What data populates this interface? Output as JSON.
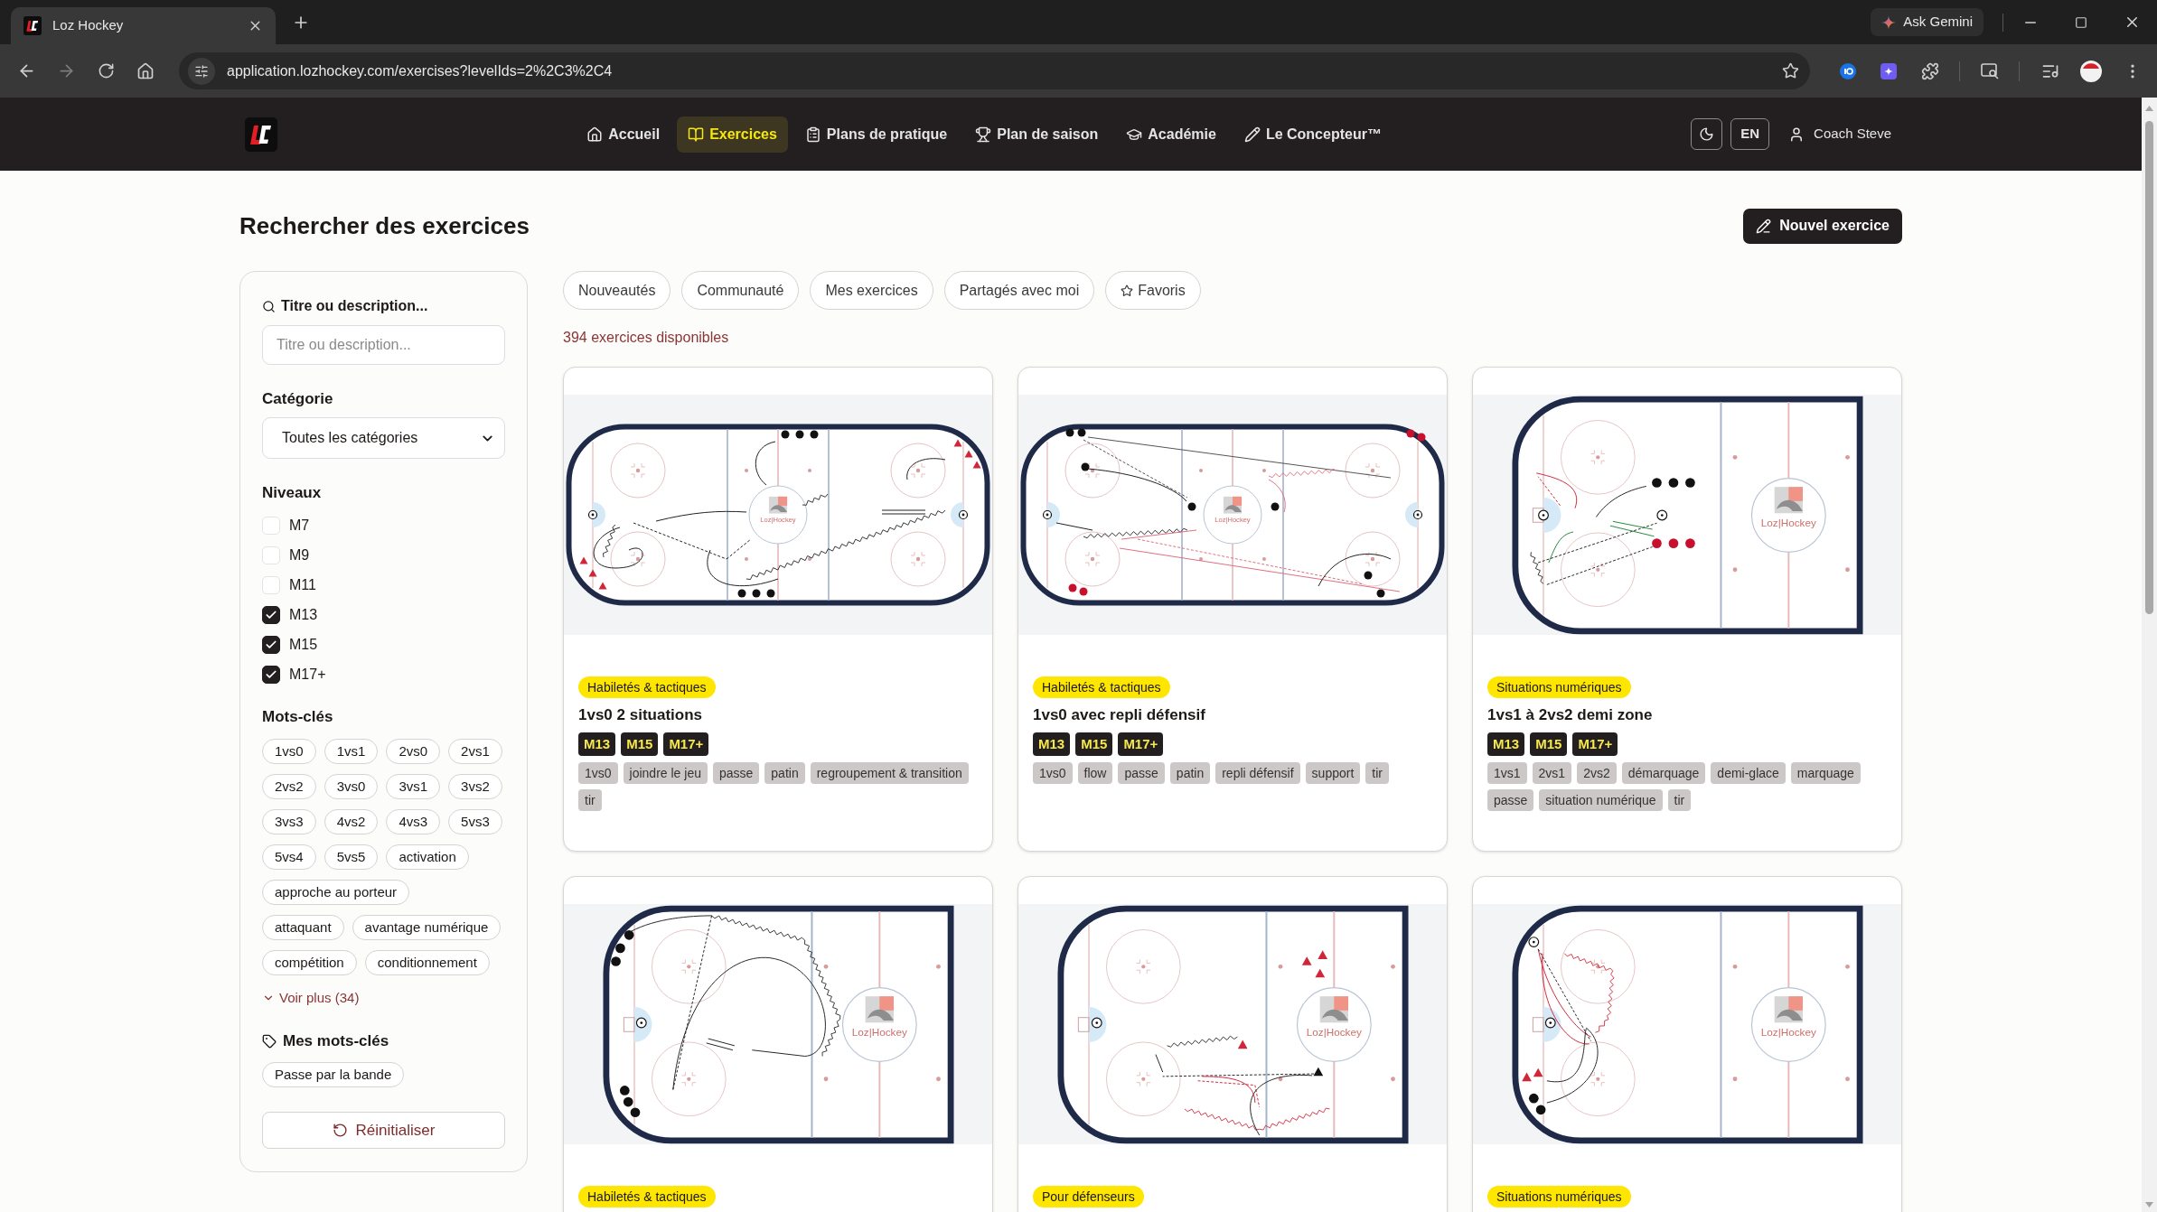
{
  "browser": {
    "tab_title": "Loz Hockey",
    "url": "application.lozhockey.com/exercises?levelIds=2%2C3%2C4",
    "assistant_button": "Ask Gemini"
  },
  "header": {
    "nav": [
      {
        "label": "Accueil",
        "selected": false
      },
      {
        "label": "Exercices",
        "selected": true
      },
      {
        "label": "Plans de pratique",
        "selected": false
      },
      {
        "label": "Plan de saison",
        "selected": false
      },
      {
        "label": "Académie",
        "selected": false
      },
      {
        "label": "Le Concepteur™",
        "selected": false
      }
    ],
    "language": "EN",
    "user": "Coach Steve"
  },
  "page": {
    "title": "Rechercher des exercices",
    "new_button": "Nouvel exercice"
  },
  "filters": {
    "search": {
      "label": "Titre ou description...",
      "placeholder": "Titre ou description..."
    },
    "category": {
      "label": "Catégorie",
      "value": "Toutes les catégories"
    },
    "levels": {
      "label": "Niveaux",
      "items": [
        {
          "label": "M7",
          "checked": false
        },
        {
          "label": "M9",
          "checked": false
        },
        {
          "label": "M11",
          "checked": false
        },
        {
          "label": "M13",
          "checked": true
        },
        {
          "label": "M15",
          "checked": true
        },
        {
          "label": "M17+",
          "checked": true
        }
      ]
    },
    "keywords": {
      "label": "Mots-clés",
      "items": [
        "1vs0",
        "1vs1",
        "2vs0",
        "2vs1",
        "2vs2",
        "3vs0",
        "3vs1",
        "3vs2",
        "3vs3",
        "4vs2",
        "4vs3",
        "5vs3",
        "5vs4",
        "5vs5",
        "activation",
        "approche au porteur",
        "attaquant",
        "avantage numérique",
        "compétition",
        "conditionnement"
      ],
      "more": "Voir plus (34)"
    },
    "my_keywords": {
      "label": "Mes mots-clés",
      "items": [
        "Passe par la bande"
      ]
    },
    "reset": "Réinitialiser"
  },
  "tabs": [
    {
      "label": "Nouveautés",
      "selected": false,
      "kind": "text"
    },
    {
      "label": "Communauté",
      "selected": false,
      "kind": "text"
    },
    {
      "label": "Mes exercices",
      "selected": false,
      "kind": "text"
    },
    {
      "label": "Partagés avec moi",
      "selected": false,
      "kind": "text"
    },
    {
      "label": "Favoris",
      "selected": false,
      "kind": "icon"
    }
  ],
  "count": "394 exercices disponibles",
  "exercises": [
    {
      "kind": "full",
      "category": "Habiletés & tactiques",
      "title": "1vs0 2 situations",
      "levels": [
        "M13",
        "M15",
        "M17+"
      ],
      "tags": [
        "1vs0",
        "joindre le jeu",
        "passe",
        "patin",
        "regroupement & transition",
        "tir"
      ],
      "logo_text": "Loz|Hockey"
    },
    {
      "kind": "full",
      "category": "Habiletés & tactiques",
      "title": "1vs0 avec repli défensif",
      "levels": [
        "M13",
        "M15",
        "M17+"
      ],
      "tags": [
        "1vs0",
        "flow",
        "passe",
        "patin",
        "repli défensif",
        "support",
        "tir"
      ],
      "logo_text": "Loz|Hockey"
    },
    {
      "kind": "half",
      "category": "Situations numériques",
      "title": "1vs1 à 2vs2 demi zone",
      "levels": [
        "M13",
        "M15",
        "M17+"
      ],
      "tags": [
        "1vs1",
        "2vs1",
        "2vs2",
        "démarquage",
        "demi-glace",
        "marquage",
        "passe",
        "situation numérique",
        "tir"
      ],
      "logo_text": "Loz|Hockey"
    },
    {
      "kind": "half",
      "category": "Habiletés & tactiques",
      "logo_text": "Loz|Hockey"
    },
    {
      "kind": "half",
      "category": "Pour défenseurs",
      "logo_text": "Loz|Hockey"
    },
    {
      "kind": "half",
      "category": "Situations numériques",
      "logo_text": "Loz|Hockey"
    }
  ]
}
